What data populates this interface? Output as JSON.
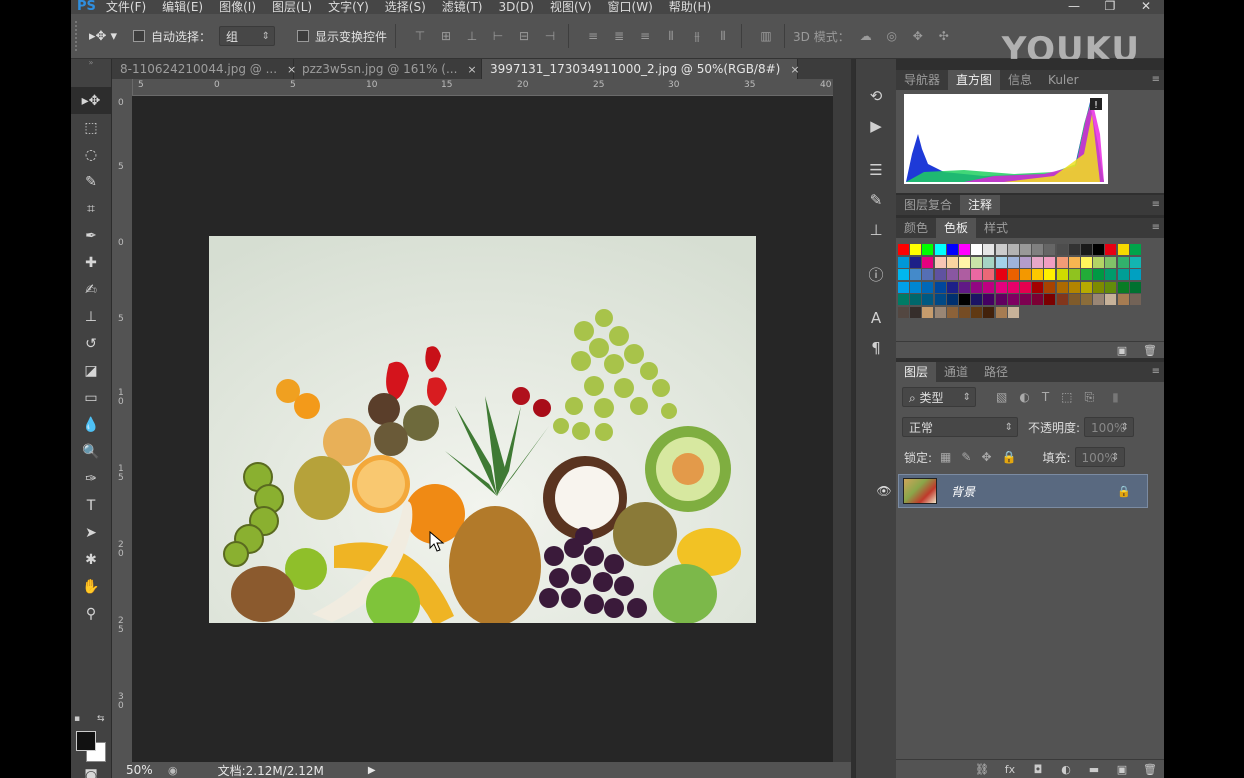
{
  "app": {
    "logo": "PS",
    "watermark": "YOUKU"
  },
  "menu": [
    "文件(F)",
    "编辑(E)",
    "图像(I)",
    "图层(L)",
    "文字(Y)",
    "选择(S)",
    "滤镜(T)",
    "3D(D)",
    "视图(V)",
    "窗口(W)",
    "帮助(H)"
  ],
  "options": {
    "auto_select_label": "自动选择：",
    "auto_select_value": "组",
    "transform_label": "显示变换控件",
    "mode3d_label": "3D 模式："
  },
  "tabs": [
    {
      "label": "8-110624210044.jpg @ ...",
      "close": "×"
    },
    {
      "label": "pzz3w5sn.jpg @ 161% (...",
      "close": "×"
    },
    {
      "label": "3997131_173034911000_2.jpg @ 50%(RGB/8#)",
      "close": "×"
    }
  ],
  "ruler_top": [
    "5",
    "0",
    "5",
    "10",
    "15",
    "20",
    "25",
    "30",
    "35",
    "40"
  ],
  "ruler_left": [
    "0",
    "5",
    "0",
    "5",
    "1 0",
    "1 5",
    "2 0",
    "2 5",
    "3 0"
  ],
  "status": {
    "zoom": "50%",
    "doc_info": "文档:2.12M/2.12M"
  },
  "panels": {
    "nav_tabs": [
      "导航器",
      "直方图",
      "信息",
      "Kuler"
    ],
    "comp_tabs": [
      "图层复合",
      "注释"
    ],
    "color_tabs": [
      "颜色",
      "色板",
      "样式"
    ],
    "layer_tabs": [
      "图层",
      "通道",
      "路径"
    ],
    "filter_kind": "类型",
    "blend_mode": "正常",
    "opacity_label": "不透明度:",
    "opacity_value": "100%",
    "lock_label": "锁定:",
    "fill_label": "填充:",
    "fill_value": "100%",
    "layer_name": "背景"
  },
  "colors": {
    "ui_dark": "#2b2b2b",
    "ui_panel": "#535353",
    "selected_layer": "#596980",
    "logo_blue": "#2f8fe0"
  },
  "swatch_rows": [
    [
      "#ff0000",
      "#ffff00",
      "#00ff00",
      "#00ffff",
      "#0000ff",
      "#ff00ff",
      "#ffffff",
      "#e6e6e6",
      "#cccccc",
      "#b3b3b3",
      "#999999",
      "#808080",
      "#666666",
      "#4d4d4d",
      "#333333",
      "#1a1a1a",
      "#000000",
      "#e60012",
      "#f5d800",
      "#00a44a"
    ],
    [
      "#0098d8",
      "#1d2088",
      "#e4007f",
      "#f7c6b4",
      "#f9d5a0",
      "#fff4a8",
      "#c9e4a8",
      "#a5d4c4",
      "#a3d2ea",
      "#9fb3da",
      "#b49ccb",
      "#e7a7c8",
      "#f19ec2",
      "#f39b77",
      "#f8b551",
      "#fff45c",
      "#b3d465",
      "#80c269",
      "#32b16c",
      "#13b5b1"
    ],
    [
      "#00b7ee",
      "#448aca",
      "#556fb5",
      "#5f52a0",
      "#8957a1",
      "#ae5da1",
      "#ea68a2",
      "#eb6877",
      "#e60012",
      "#eb6100",
      "#f39800",
      "#fcc800",
      "#fff100",
      "#cfdb00",
      "#8fc31f",
      "#22ac38",
      "#009944",
      "#009b6b",
      "#009e96",
      "#00a0c1"
    ],
    [
      "#00a0e9",
      "#0086d1",
      "#0068b7",
      "#00479d",
      "#1d2088",
      "#601986",
      "#920783",
      "#be0081",
      "#e4007f",
      "#e5006a",
      "#e5004f",
      "#a40000",
      "#a84200",
      "#ac6a00",
      "#b28500",
      "#b7aa00",
      "#7e8b00",
      "#638c0b",
      "#097c25",
      "#007130"
    ],
    [
      "#007b65",
      "#00676b",
      "#005982",
      "#004986",
      "#00306f",
      "#000000",
      "#1b1464",
      "#440062",
      "#600060",
      "#7d0061",
      "#7d0050",
      "#7b0034",
      "#7b0000",
      "#82361c",
      "#7f5b2b",
      "#8b6d3a",
      "#998675",
      "#c7b299",
      "#a67c52",
      "#736357"
    ],
    [
      "#534741",
      "#362e2b",
      "#c69c6d",
      "#998675",
      "#8c6239",
      "#754c24",
      "#603913",
      "#42210b",
      "#a67c52",
      "#c7b299"
    ]
  ]
}
